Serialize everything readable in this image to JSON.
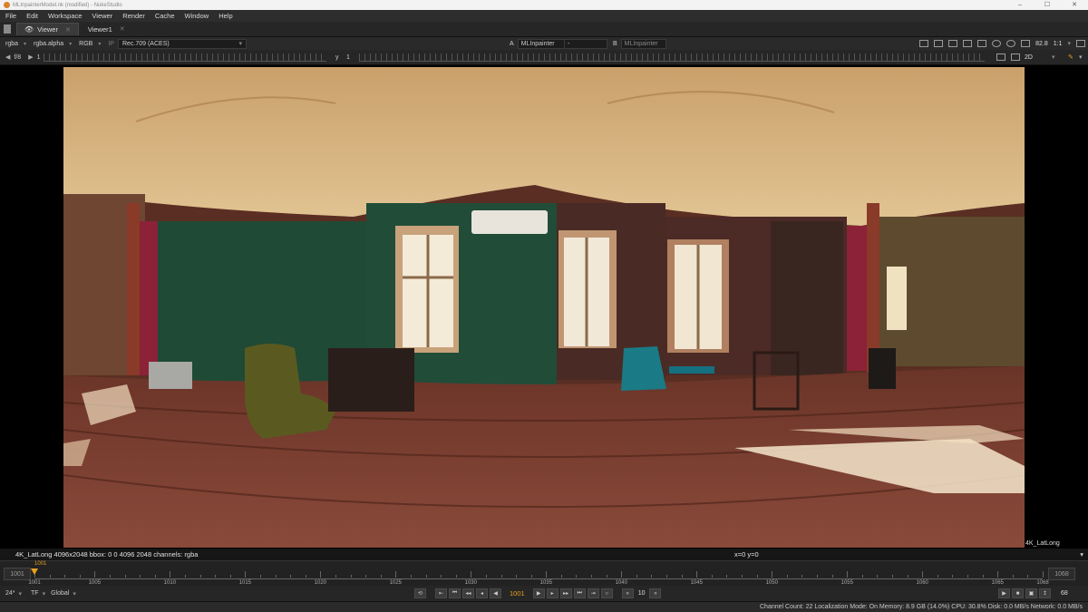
{
  "window": {
    "title": "MLInpainterModel.nk (modified) - NukeStudio",
    "controls": [
      "–",
      "☐",
      "✕"
    ]
  },
  "menu": [
    "File",
    "Edit",
    "Workspace",
    "Viewer",
    "Render",
    "Cache",
    "Window",
    "Help"
  ],
  "tabs": [
    {
      "label": "Viewer",
      "active": true
    },
    {
      "label": "Viewer1",
      "active": false
    }
  ],
  "viewer": {
    "channels": "rgba",
    "alpha_channel": "rgba.alpha",
    "display": "RGB",
    "ip_label": "IP",
    "colorspace": "Rec.709 (ACES)",
    "a_label": "A",
    "a_input": "MLInpainter",
    "compare": "-",
    "b_label": "B",
    "b_input": "MLInpainter",
    "zoom": "82.8",
    "ratio": "1:1",
    "fstop": "f/8",
    "frame_field": "1",
    "y_label": "y",
    "y_value": "1",
    "view_mode": "2D"
  },
  "image": {
    "format_label": "4K_LatLong",
    "info": "4K_LatLong 4096x2048  bbox: 0 0 4096 2048 channels: rgba",
    "coords": "x=0 y=0"
  },
  "timeline": {
    "in_frame": "1001",
    "out_frame": "1068",
    "current_frame": "1001",
    "ticks": [
      "1001",
      "1005",
      "1010",
      "1015",
      "1020",
      "1025",
      "1030",
      "1035",
      "1040",
      "1045",
      "1050",
      "1055",
      "1060",
      "1065",
      "1068"
    ],
    "playhead_fraction": 0.0
  },
  "transport": {
    "fps": "24*",
    "tf": "TF",
    "scope": "Global",
    "current": "1001",
    "step": "10",
    "frame_count": "68"
  },
  "status": {
    "text": "Channel Count: 22  Localization Mode: On  Memory: 8.9 GB (14.0%)  CPU: 30.8%  Disk: 0.0 MB/s  Network: 0.0 MB/s"
  },
  "colors": {
    "accent": "#e8a020",
    "background": "#1e1e1e",
    "panel": "#2a2a2a"
  }
}
